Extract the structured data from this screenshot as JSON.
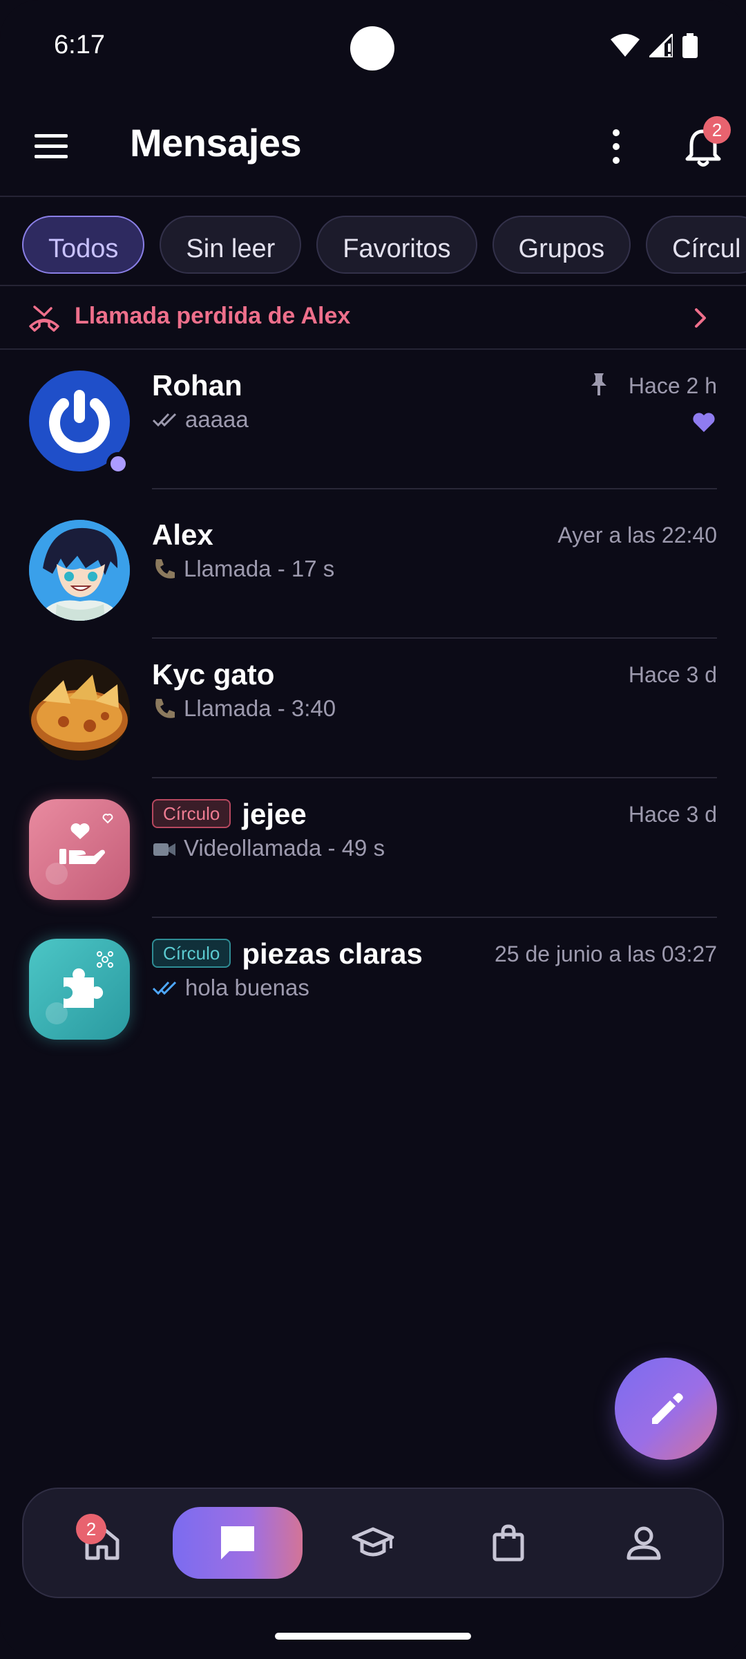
{
  "status_bar": {
    "time": "6:17",
    "icons": [
      "wifi-icon",
      "cellular-signal-icon",
      "battery-icon"
    ]
  },
  "header": {
    "title": "Mensajes",
    "notification_count": "2",
    "icons": [
      "menu-icon",
      "more-vertical-icon",
      "bell-icon"
    ]
  },
  "filters": {
    "chips": [
      {
        "label": "Todos",
        "active": true
      },
      {
        "label": "Sin leer",
        "active": false
      },
      {
        "label": "Favoritos",
        "active": false
      },
      {
        "label": "Grupos",
        "active": false
      },
      {
        "label": "Círcul",
        "active": false
      }
    ]
  },
  "missed_call": {
    "text": "Llamada perdida de Alex",
    "color": "#ee6f8b"
  },
  "conversations": [
    {
      "name": "Rohan",
      "time": "Hace 2 h",
      "preview": "aaaaa",
      "pinned": true,
      "favorite": true,
      "online": true,
      "read_icon": "double-check-icon"
    },
    {
      "name": "Alex",
      "time": "Ayer a las 22:40",
      "preview": "Llamada - 17 s",
      "read_icon": "phone-icon"
    },
    {
      "name": "Kyc gato",
      "time": "Hace 3 d",
      "preview": "Llamada - 3:40",
      "read_icon": "phone-icon"
    },
    {
      "name": "jejee",
      "tag": "Círculo",
      "time": "Hace 3 d",
      "preview": "Videollamada - 49 s",
      "read_icon": "video-camera-icon"
    },
    {
      "name": "piezas claras",
      "tag": "Círculo",
      "time": "25 de junio a las 03:27",
      "preview": "hola buenas",
      "read_icon": "double-check-read-icon"
    }
  ],
  "fab": {
    "icon": "pencil-icon"
  },
  "bottom_nav": {
    "home_badge": "2",
    "items": [
      "home-icon",
      "chat-icon",
      "graduation-cap-icon",
      "shopping-bag-icon",
      "profile-icon"
    ],
    "active": "chat-icon"
  },
  "colors": {
    "background": "#0c0b17",
    "accent": "#7b6cf0",
    "accent_pink": "#d37497",
    "badge": "#e8636f"
  }
}
